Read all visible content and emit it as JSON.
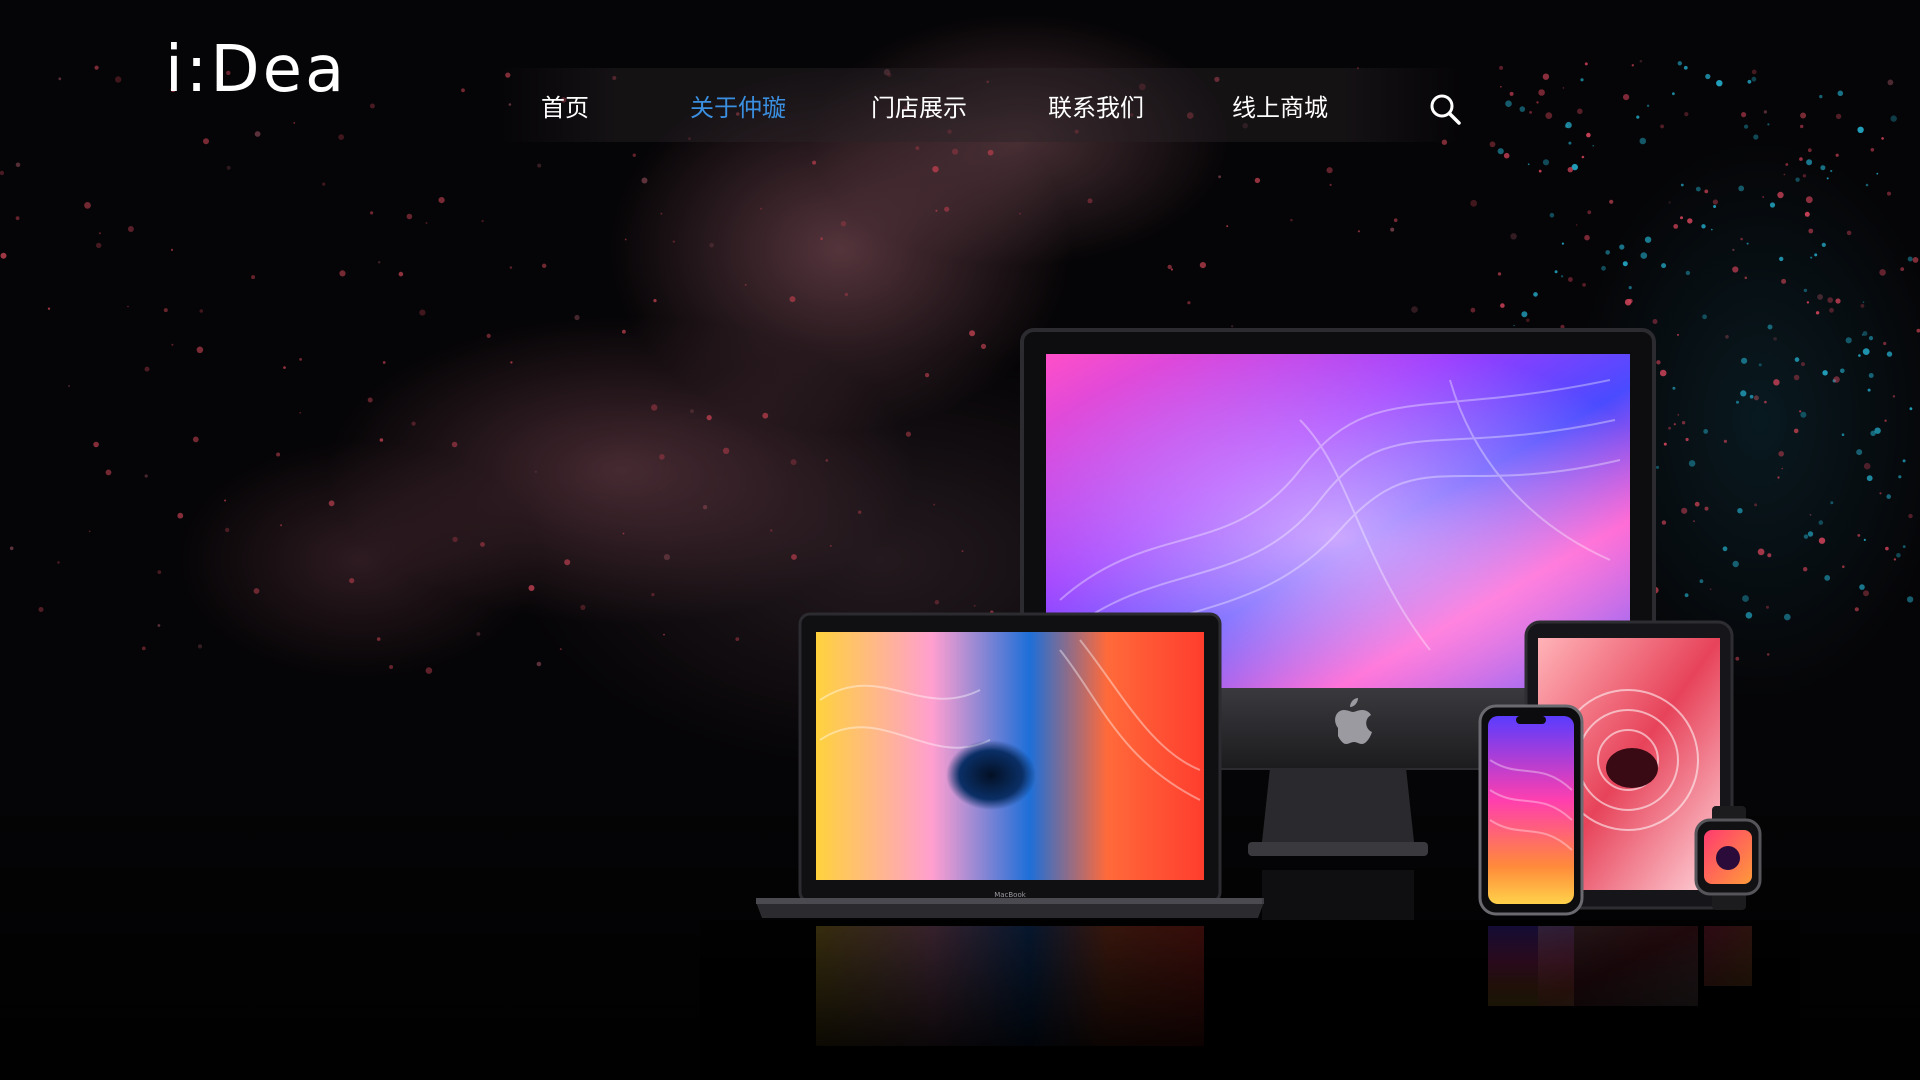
{
  "brand": {
    "logo_text": "i:Dea"
  },
  "nav": {
    "items": [
      {
        "label": "首页",
        "active": false
      },
      {
        "label": "关于仲璇",
        "active": true
      },
      {
        "label": "门店展示",
        "active": false
      },
      {
        "label": "联系我们",
        "active": false
      },
      {
        "label": "线上商城",
        "active": false
      }
    ],
    "search_icon": "search-icon"
  },
  "hero": {
    "device_labels": {
      "laptop_brand": "MacBook"
    }
  },
  "colors": {
    "background": "#050406",
    "nav_text": "#ffffff",
    "nav_active": "#3a8fe0"
  }
}
